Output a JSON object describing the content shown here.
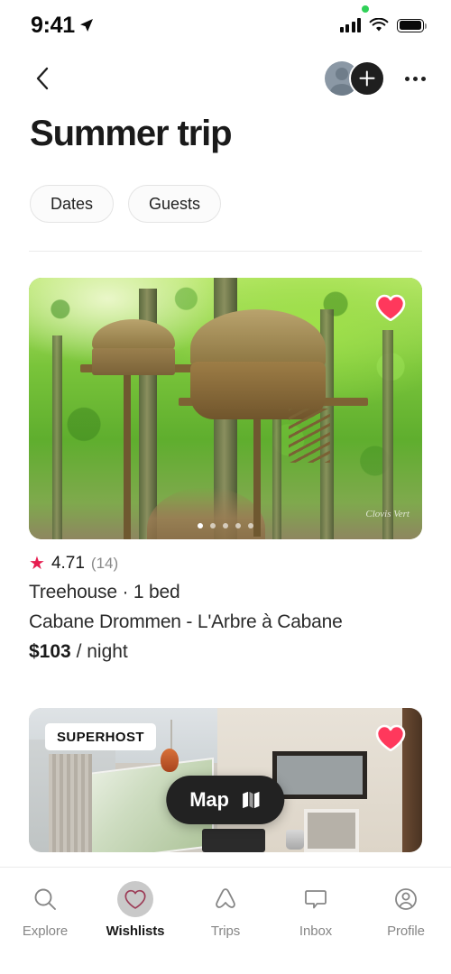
{
  "status_bar": {
    "time": "9:41",
    "location_icon": "location-arrow-icon",
    "recording_dot": "green-recording-dot",
    "signal_icon": "cellular-signal-icon",
    "wifi_icon": "wifi-icon",
    "battery_icon": "battery-full-icon"
  },
  "nav": {
    "back_icon": "chevron-left-icon",
    "avatar": "member-avatar",
    "add_label": "+",
    "add_icon": "plus-icon",
    "more_icon": "more-options-icon"
  },
  "header": {
    "title": "Summer trip",
    "chips": [
      {
        "label": "Dates"
      },
      {
        "label": "Guests"
      }
    ]
  },
  "listings": [
    {
      "photo_alt": "treehouse-in-green-forest",
      "watermark": "Clovis Vert",
      "saved": true,
      "heart_icon": "heart-filled-icon",
      "carousel": {
        "count": 5,
        "active_index": 0
      },
      "rating": "4.71",
      "review_count": "(14)",
      "star_icon": "star-icon",
      "type_line": "Treehouse · 1 bed",
      "name": "Cabane Drommen - L'Arbre à Cabane",
      "price": "$103",
      "price_suffix": "/ night"
    },
    {
      "photo_alt": "bedroom-interior-with-window",
      "badge": "SUPERHOST",
      "saved": true,
      "heart_icon": "heart-filled-icon"
    }
  ],
  "map_button": {
    "label": "Map",
    "icon": "map-folded-icon"
  },
  "tabs": [
    {
      "label": "Explore",
      "icon": "search-icon",
      "active": false
    },
    {
      "label": "Wishlists",
      "icon": "heart-icon",
      "active": true
    },
    {
      "label": "Trips",
      "icon": "airbnb-belo-icon",
      "active": false
    },
    {
      "label": "Inbox",
      "icon": "message-icon",
      "active": false
    },
    {
      "label": "Profile",
      "icon": "person-icon",
      "active": false
    }
  ],
  "colors": {
    "brand_pink": "#FF385C",
    "star_pink": "#E61E50",
    "dark": "#222222",
    "muted": "#868686"
  }
}
